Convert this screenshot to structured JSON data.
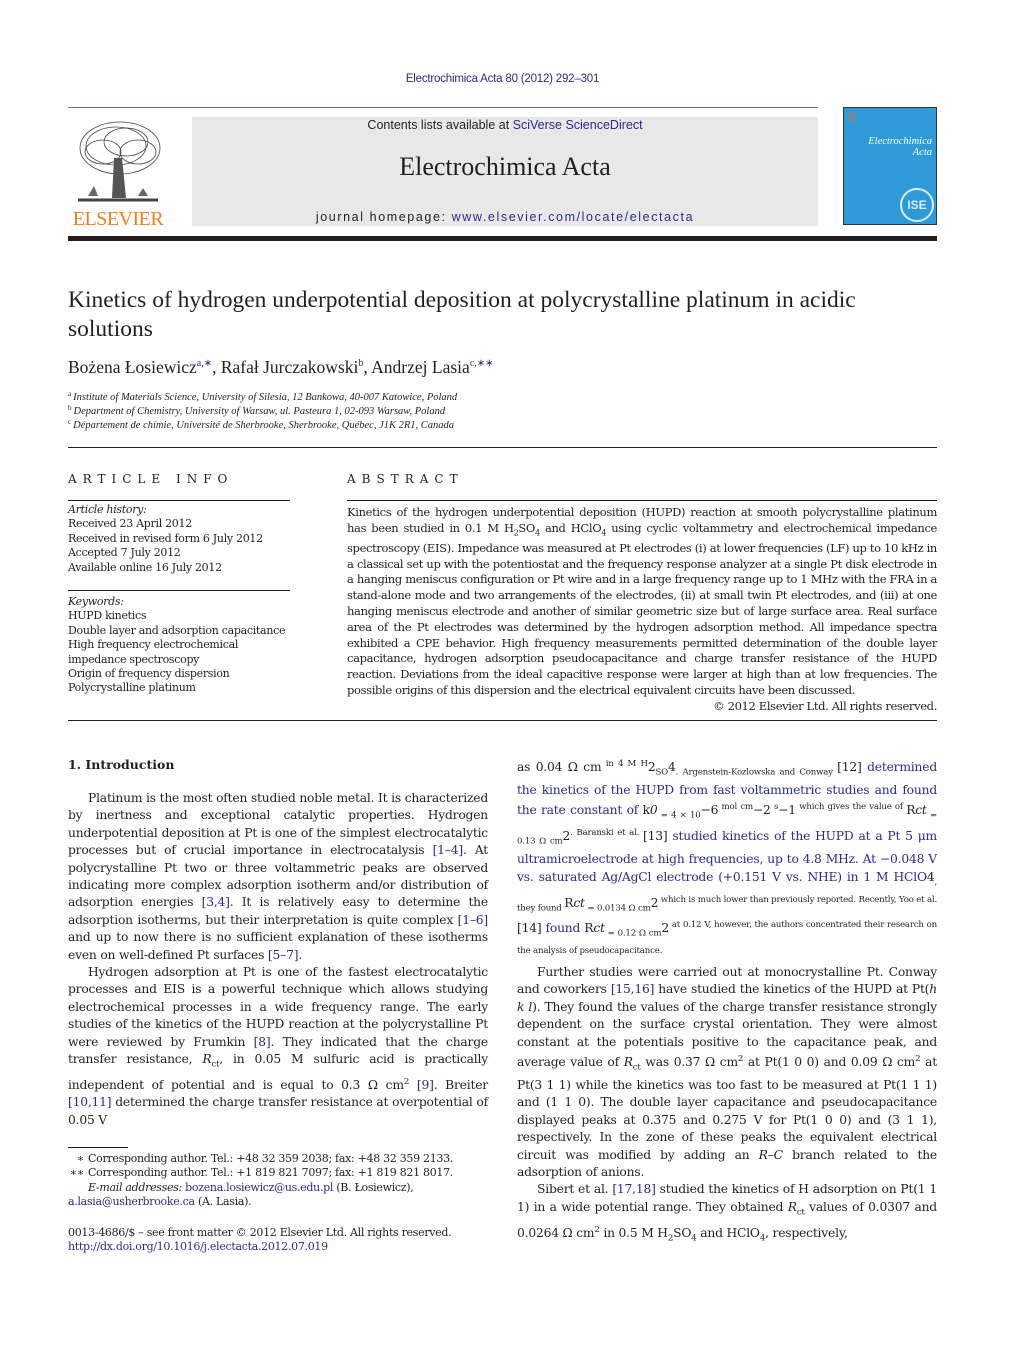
{
  "header": {
    "journal_ref": "Electrochimica Acta 80 (2012) 292–301",
    "contents_prefix": "Contents lists available at ",
    "contents_link": "SciVerse ScienceDirect",
    "journal_name": "Electrochimica Acta",
    "homepage_prefix": "journal homepage: ",
    "homepage_link": "www.elsevier.com/locate/electacta",
    "publisher_logo_text": "ELSEVIER",
    "cover_title_line1": "Electrochimica",
    "cover_title_line2": "Acta",
    "cover_badge": "ISE"
  },
  "article": {
    "title": "Kinetics of hydrogen underpotential deposition at polycrystalline platinum in acidic solutions",
    "authors": [
      {
        "name": "Bożena Łosiewicz",
        "marks": "a,∗"
      },
      {
        "name": "Rafał Jurczakowski",
        "marks": "b"
      },
      {
        "name": "Andrzej Lasia",
        "marks": "c,∗∗"
      }
    ],
    "affiliations": [
      {
        "mark": "a",
        "text": "Institute of Materials Science, University of Silesia, 12 Bankowa, 40-007 Katowice, Poland"
      },
      {
        "mark": "b",
        "text": "Department of Chemistry, University of Warsaw, ul. Pasteura 1, 02-093 Warsaw, Poland"
      },
      {
        "mark": "c",
        "text": "Département de chimie, Université de Sherbrooke, Sherbrooke, Québec, J1K 2R1, Canada"
      }
    ]
  },
  "article_info": {
    "heading": "ARTICLE INFO",
    "history_label": "Article history:",
    "history": [
      "Received 23 April 2012",
      "Received in revised form 6 July 2012",
      "Accepted 7 July 2012",
      "Available online 16 July 2012"
    ],
    "keywords_label": "Keywords:",
    "keywords": [
      "HUPD kinetics",
      "Double layer and adsorption capacitance",
      "High frequency electrochemical impedance spectroscopy",
      "Origin of frequency dispersion",
      "Polycrystalline platinum"
    ]
  },
  "abstract": {
    "heading": "ABSTRACT",
    "part1": "Kinetics of the hydrogen underpotential deposition (HUPD) reaction at smooth polycrystalline platinum has been studied in 0.1 M H",
    "part2": "SO",
    "part3": " and HClO",
    "part4": " using cyclic voltammetry and electrochemical impedance spectroscopy (EIS). Impedance was measured at Pt electrodes (i) at lower frequencies (LF) up to 10 kHz in a classical set up with the potentiostat and the frequency response analyzer at a single Pt disk electrode in a hanging meniscus configuration or Pt wire and in a large frequency range up to 1 MHz with the FRA in a stand-alone mode and two arrangements of the electrodes, (ii) at small twin Pt electrodes, and (iii) at one hanging meniscus electrode and another of similar geometric size but of large surface area. Real surface area of the Pt electrodes was determined by the hydrogen adsorption method. All impedance spectra exhibited a CPE behavior. High frequency measurements permitted determination of the double layer capacitance, hydrogen adsorption pseudocapacitance and charge transfer resistance of the HUPD reaction. Deviations from the ideal capacitive response were larger at high than at low frequencies. The possible origins of this dispersion and the electrical equivalent circuits have been discussed.",
    "sub2": "2",
    "sub4": "4",
    "copyright": "© 2012 Elsevier Ltd. All rights reserved."
  },
  "introduction": {
    "heading": "1.  Introduction",
    "p1": [
      "Platinum is the most often studied noble metal. It is characterized by inertness and exceptional catalytic properties. Hydrogen underpotential deposition at Pt is one of the simplest electrocatalytic processes but of crucial importance in electrocatalysis ",
      "[1–4]",
      ". At polycrystalline Pt two or three voltammetric peaks are observed indicating more complex adsorption isotherm and/or distribution of adsorption energies ",
      "[3,4]",
      ". It is relatively easy to determine the adsorption isotherms, but their interpretation is quite complex ",
      "[1–6]",
      " and up to now there is no sufficient explanation of these isotherms even on well-defined Pt surfaces ",
      "[5–7]",
      "."
    ],
    "p2": [
      "Hydrogen adsorption at Pt is one of the fastest electrocatalytic processes and EIS is a powerful technique which allows studying electrochemical processes in a wide frequency range. The early studies of the kinetics of the HUPD reaction at the polycrystalline Pt were reviewed by Frumkin ",
      "[8]",
      ". They indicated that the charge transfer resistance, ",
      "R",
      "ct",
      ", in 0.05 M sulfuric acid is practically independent of potential and is equal to 0.3 Ω cm",
      "2",
      " ",
      "[9]",
      ". Breiter ",
      "[10,11]",
      " determined the charge transfer resistance at overpotential of 0.05 V as 0.04 Ω cm",
      "2",
      " in 4 M H",
      "2",
      "SO",
      "4",
      ". Argenstein-Kozlowska and Conway ",
      "[12]",
      " determined the kinetics of the HUPD from fast voltammetric studies and found the rate constant of ",
      "k",
      "0",
      " = 4 × 10",
      "−6",
      " mol cm",
      "−2",
      " s",
      "−1",
      " which gives the value of ",
      "R",
      "ct",
      " = 0.13 Ω cm",
      "2",
      ". Baranski et al. ",
      "[13]",
      " studied kinetics of the HUPD at a Pt 5 μm ultramicroelectrode at high frequencies, up to 4.8 MHz. At −0.048 V vs. saturated Ag/AgCl electrode (+0.151 V vs. NHE) in 1 M HClO",
      "4",
      ", they found ",
      "R",
      "ct",
      " = 0.0134 Ω cm",
      "2",
      " which is much lower than previously reported. Recently, Yoo et al. ",
      "[14]",
      " found ",
      "R",
      "ct",
      " = 0.12 Ω cm",
      "2",
      " at 0.12 V, however, the authors concentrated their research on the analysis of pseudocapacitance."
    ],
    "p3": [
      "Further studies were carried out at monocrystalline Pt. Conway and coworkers ",
      "[15,16]",
      " have studied the kinetics of the HUPD at Pt(",
      "h k l",
      "). They found the values of the charge transfer resistance strongly dependent on the surface crystal orientation. They were almost constant at the potentials positive to the capacitance peak, and average value of ",
      "R",
      "ct",
      " was 0.37 Ω cm",
      "2",
      " at Pt(1 0 0) and 0.09 Ω cm",
      "2",
      " at Pt(3 1 1) while the kinetics was too fast to be measured at Pt(1 1 1) and (1 1 0). The double layer capacitance and pseudocapacitance displayed peaks at 0.375 and 0.275 V for Pt(1 0 0) and (3 1 1), respectively. In the zone of these peaks the equivalent electrical circuit was modified by adding an ",
      "R–C",
      " branch related to the adsorption of anions."
    ],
    "p4": [
      "Sibert et al. ",
      "[17,18]",
      " studied the kinetics of H adsorption on Pt(1 1 1) in a wide potential range. They obtained ",
      "R",
      "ct",
      " values of 0.0307 and 0.0264 Ω cm",
      "2",
      " in 0.5 M H",
      "2",
      "SO",
      "4",
      " and HClO",
      "4",
      ", respectively,"
    ]
  },
  "footnotes": {
    "fn1_mark": "∗",
    "fn1_text": "Corresponding author. Tel.: +48 32 359 2038; fax: +48 32 359 2133.",
    "fn2_mark": "∗∗",
    "fn2_text": "Corresponding author. Tel.: +1 819 821 7097; fax: +1 819 821 8017.",
    "email_label": "E-mail addresses:",
    "email1": "bozena.losiewicz@us.edu.pl",
    "email1_owner": " (B. Łosiewicz),",
    "email2": "a.lasia@usherbrooke.ca",
    "email2_owner": " (A. Lasia).",
    "issn_line": "0013-4686/$ – see front matter © 2012 Elsevier Ltd. All rights reserved.",
    "doi": "http://dx.doi.org/10.1016/j.electacta.2012.07.019"
  },
  "colors": {
    "link": "#2b2b8c",
    "elsevier_orange": "#f07f1b",
    "masthead_bg": "#e8e8e8",
    "cover_blue": "#2f9ad8",
    "text": "#231f20"
  }
}
